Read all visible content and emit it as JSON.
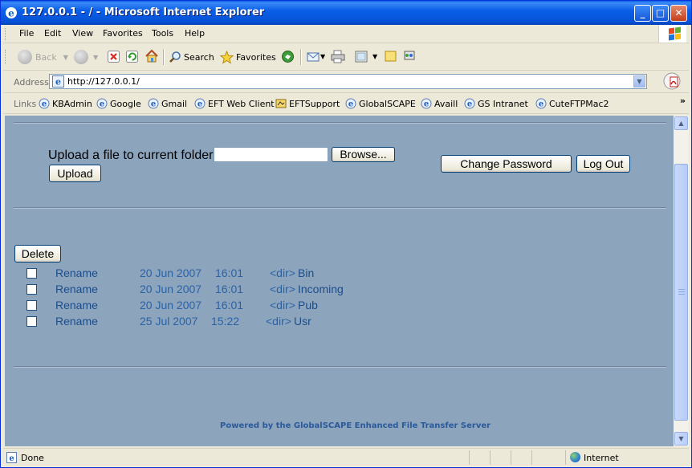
{
  "window": {
    "title": "127.0.0.1 - / - Microsoft Internet Explorer",
    "min_label": "_",
    "max_label": "□",
    "close_label": "✕"
  },
  "menu": [
    "File",
    "Edit",
    "View",
    "Favorites",
    "Tools",
    "Help"
  ],
  "toolbar": {
    "back_label": "Back",
    "search_label": "Search",
    "favorites_label": "Favorites"
  },
  "address": {
    "label": "Address",
    "url": "http://127.0.0.1/"
  },
  "links": {
    "label": "Links",
    "items": [
      "KBAdmin",
      "Google",
      "Gmail",
      "EFT Web Client",
      "EFTSupport",
      "GlobalSCAPE",
      "Availl",
      "GS Intranet",
      "CuteFTPMac2"
    ],
    "more_label": "»"
  },
  "page": {
    "upload_label": "Upload a file to current folder:",
    "browse_label": "Browse...",
    "upload_button": "Upload",
    "change_password_button": "Change Password",
    "logout_button": "Log Out",
    "delete_button": "Delete",
    "rows": [
      {
        "action": "Rename",
        "date": "20 Jun 2007",
        "time": "16:01",
        "type": "<dir>",
        "name": "Bin"
      },
      {
        "action": "Rename",
        "date": "20 Jun 2007",
        "time": "16:01",
        "type": "<dir>",
        "name": "Incoming"
      },
      {
        "action": "Rename",
        "date": "20 Jun 2007",
        "time": "16:01",
        "type": "<dir>",
        "name": "Pub"
      },
      {
        "action": "Rename",
        "date": "25 Jul 2007",
        "time": "15:22",
        "type": "<dir>",
        "name": "Usr"
      }
    ],
    "footer": "Powered by the GlobalSCAPE Enhanced File Transfer Server"
  },
  "status": {
    "text": "Done",
    "zone": "Internet"
  },
  "colors": {
    "page_background": "#8da4bd",
    "link_blue": "#1b4d8a",
    "title_bar": "#0651d6"
  }
}
